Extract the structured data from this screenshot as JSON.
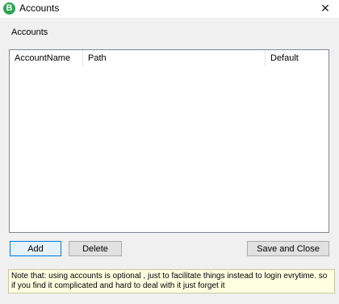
{
  "window": {
    "title": "Accounts",
    "app_icon_letter": "B",
    "close_glyph": "✕"
  },
  "section_label": "Accounts",
  "table": {
    "columns": [
      "AccountName",
      "Path",
      "Default"
    ],
    "rows": []
  },
  "buttons": {
    "add": "Add",
    "delete": "Delete",
    "save_close": "Save and Close"
  },
  "note": "Note that: using accounts is optional , just to facilitate things instead to login evrytime. so if you find it complicated and hard to deal with it just forget it",
  "colors": {
    "app_icon": "#2da44e",
    "note_background": "#ffffe1",
    "focus_border": "#0078d7"
  }
}
